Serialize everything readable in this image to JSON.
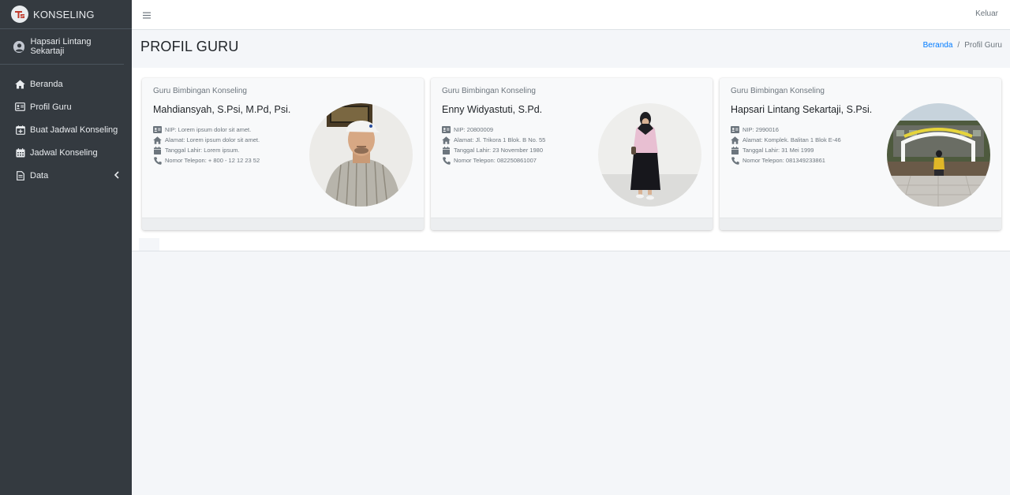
{
  "brand": {
    "name": "KONSELING"
  },
  "user": {
    "name": "Hapsari Lintang Sekartaji"
  },
  "sidebar": {
    "items": [
      {
        "label": "Beranda",
        "icon": "home-icon"
      },
      {
        "label": "Profil Guru",
        "icon": "id-card-icon"
      },
      {
        "label": "Buat Jadwal Konseling",
        "icon": "calendar-plus-icon"
      },
      {
        "label": "Jadwal Konseling",
        "icon": "calendar-icon"
      },
      {
        "label": "Data",
        "icon": "file-icon",
        "expand_icon": "chevron-left-icon"
      }
    ]
  },
  "topbar": {
    "logout_label": "Keluar"
  },
  "header": {
    "title": "PROFIL GURU",
    "breadcrumb": {
      "home": "Beranda",
      "separator": "/",
      "current": "Profil Guru"
    }
  },
  "cards": [
    {
      "subtitle": "Guru Bimbingan Konseling",
      "name": "Mahdiansyah, S.Psi, M.Pd, Psi.",
      "nip": "NIP: Lorem ipsum dolor sit amet.",
      "address": "Alamat: Lorem ipsum dolor sit amet.",
      "birth": "Tanggal Lahir: Lorem ipsum.",
      "phone": "Nomor Telepon: + 800 - 12 12 23 52"
    },
    {
      "subtitle": "Guru Bimbingan Konseling",
      "name": "Enny Widyastuti, S.Pd.",
      "nip": "NIP: 20800009",
      "address": "Alamat: Jl. Trikora 1 Blok. B No. 55",
      "birth": "Tanggal Lahir: 23 November 1980",
      "phone": "Nomor Telepon: 082250861007"
    },
    {
      "subtitle": "Guru Bimbingan Konseling",
      "name": "Hapsari Lintang Sekartaji, S.Psi.",
      "nip": "NIP: 2990016",
      "address": "Alamat: Komplek. Balitan 1 Blok E-46",
      "birth": "Tanggal Lahir: 31 Mei 1999",
      "phone": "Nomor Telepon: 081349233861"
    }
  ],
  "colors": {
    "sidebar_bg": "#343a40",
    "link": "#007bff",
    "page_bg": "#f4f6f9"
  }
}
